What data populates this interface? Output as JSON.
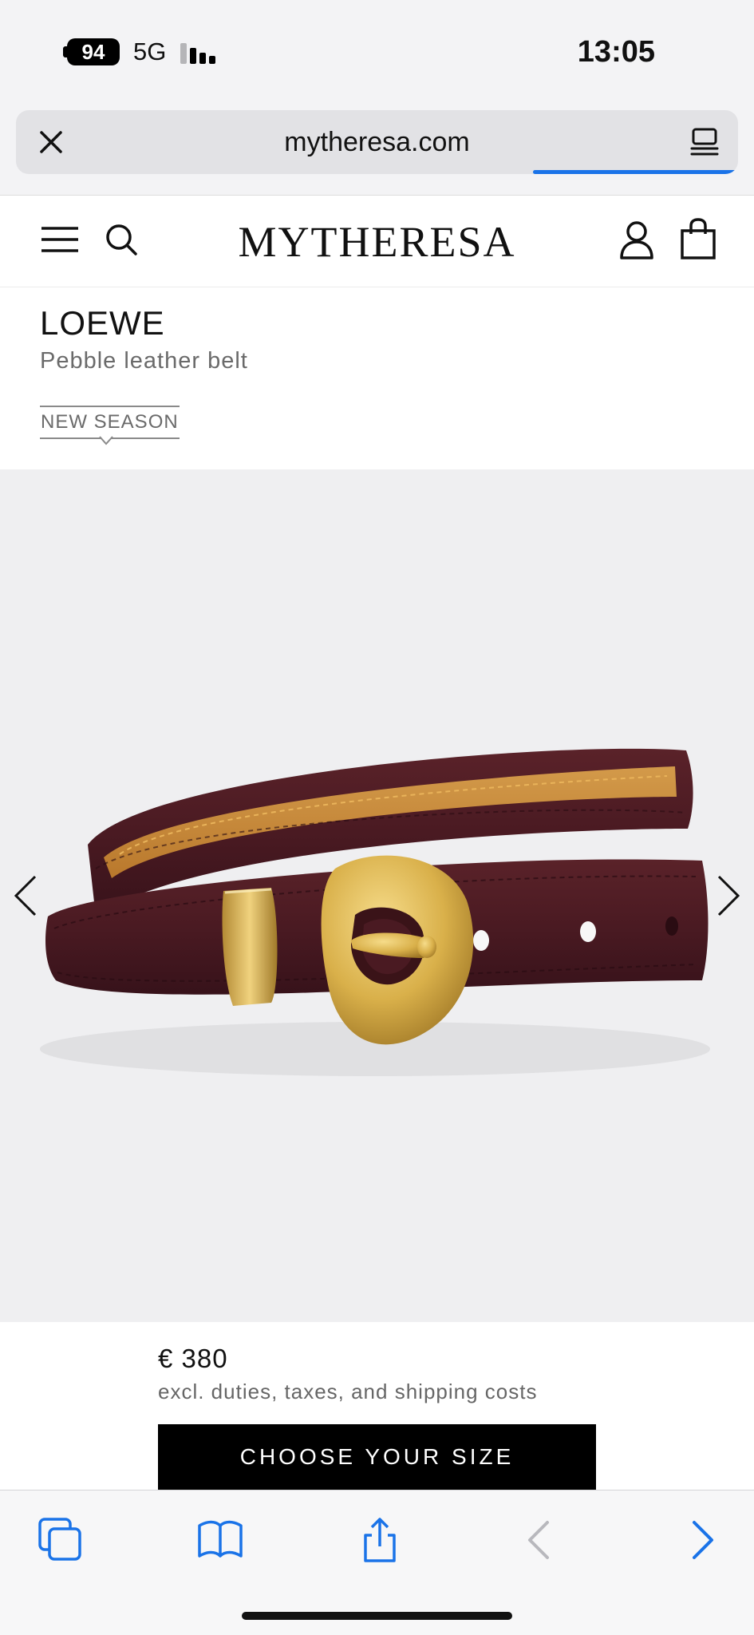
{
  "status_bar": {
    "battery": "94",
    "network": "5G",
    "time": "13:05"
  },
  "browser": {
    "url": "mytheresa.com",
    "close_icon": "close-icon",
    "reader_icon": "reader-mode-icon",
    "accent_color": "#1a73e8"
  },
  "site_header": {
    "logo": "MYTHERESA",
    "menu_icon": "hamburger-menu-icon",
    "search_icon": "search-icon",
    "account_icon": "user-icon",
    "bag_icon": "shopping-bag-icon"
  },
  "product": {
    "brand": "LOEWE",
    "name": "Pebble leather belt",
    "badge": "NEW SEASON",
    "image": {
      "alt_icons": [
        "chevron-left-icon",
        "chevron-right-icon"
      ],
      "leather_color": "#4a1a22",
      "lining_color": "#c98a3a",
      "buckle_color": "#d9b04a"
    },
    "price": "€ 380",
    "price_note": "excl. duties, taxes, and shipping costs",
    "cta_label": "CHOOSE YOUR SIZE"
  },
  "toolbar": {
    "items": [
      "tabs-icon",
      "bookmarks-icon",
      "share-icon",
      "back-icon",
      "forward-icon"
    ],
    "accent_color": "#1a73e8"
  }
}
